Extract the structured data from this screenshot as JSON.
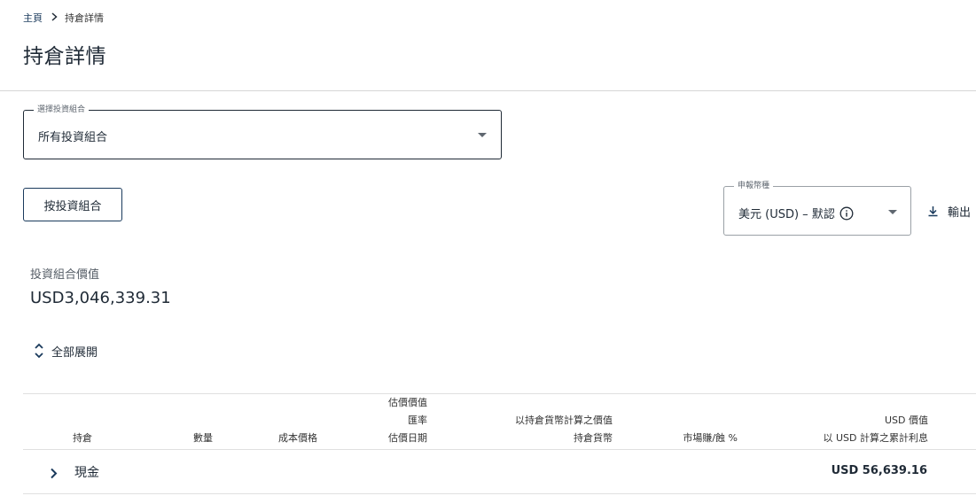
{
  "breadcrumb": {
    "home": "主頁",
    "current": "持倉詳情"
  },
  "page": {
    "title": "持倉詳情"
  },
  "portfolio_select": {
    "label": "選擇投資組合",
    "value": "所有投資組合"
  },
  "by_portfolio_button": {
    "label": "按投資組合"
  },
  "currency_select": {
    "label": "申報幣種",
    "value": "美元 (USD) – 默認"
  },
  "export": {
    "label": "輸出"
  },
  "portfolio_value": {
    "label": "投資組合價值",
    "value": "USD3,046,339.31"
  },
  "expand_all": {
    "label": "全部展開"
  },
  "table": {
    "headers": {
      "holding": "持倉",
      "quantity": "數量",
      "cost_price": "成本價格",
      "valuation_price": "估價價值",
      "fx_rate": "匯率",
      "valuation_date": "估價日期",
      "value_in_holding_ccy": "以持倉貨幣計算之價值",
      "holding_ccy": "持倉貨幣",
      "market_gain_loss": "市場賺/蝕 %",
      "usd_value": "USD 價值",
      "accrued_interest_usd": "以 USD 計算之累計利息"
    },
    "rows": [
      {
        "name": "現金",
        "amount": "USD 56,639.16"
      }
    ]
  },
  "colors": {
    "primary": "#1a3a5c",
    "text": "#1f2a36",
    "divider": "#d6d6d6"
  },
  "icons": [
    "chevron-right-icon",
    "caret-down-icon",
    "info-icon",
    "download-icon",
    "expand-collapse-icon"
  ]
}
